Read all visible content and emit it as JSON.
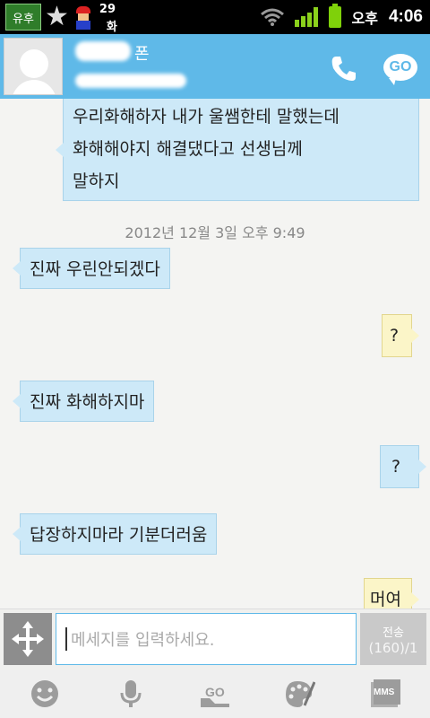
{
  "status_bar": {
    "app_badge": "유후",
    "date_day": "29",
    "date_dow": "화",
    "ampm": "오후",
    "time": "4:06"
  },
  "header": {
    "name_suffix": "폰",
    "go_label": "GO"
  },
  "messages": [
    {
      "direction": "in",
      "text_lines": [
        "우리화해하자 내가 울쌤한테 말했는데",
        "화해해야지 해결댔다고 선생님께",
        "말하지"
      ]
    },
    {
      "direction": "in",
      "text": "진짜 우린안되겠다"
    },
    {
      "direction": "out",
      "text": "?"
    },
    {
      "direction": "in",
      "text": "진짜 화해하지마"
    },
    {
      "direction": "out",
      "text": "?"
    },
    {
      "direction": "in",
      "text": "답장하지마라 기분더러움"
    },
    {
      "direction": "out",
      "text": "머여"
    }
  ],
  "timestamp": "2012년 12월 3일 오후 9:49",
  "composer": {
    "placeholder": "메세지를 입력하세요.",
    "send_label": "전송",
    "char_count": "(160)/1"
  },
  "toolbar": {
    "mms_label": "MMS"
  },
  "colors": {
    "header_bg": "#5fb9e8",
    "incoming_bubble": "#cde9f8",
    "outgoing_bubble": "#fbf5c8"
  }
}
